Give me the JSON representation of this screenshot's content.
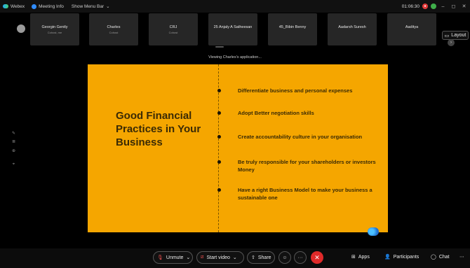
{
  "titlebar": {
    "app_name": "Webex",
    "meeting_info": "Meeting Info",
    "show_menu_bar": "Show Menu Bar",
    "time": "01:06:30"
  },
  "participants": [
    {
      "name": "Georgin Gently",
      "status": "Cohost, me"
    },
    {
      "name": "Charles",
      "status": "Cohost"
    },
    {
      "name": "CRJ",
      "status": "Cohost"
    },
    {
      "name": "25 Anjaly A Satheesan",
      "status": ""
    },
    {
      "name": "45_Bibin Benny",
      "status": ""
    },
    {
      "name": "Aadarsh Suresh",
      "status": ""
    },
    {
      "name": "Aaditya",
      "status": ""
    }
  ],
  "layout_label": "Layout",
  "viewing_text": "Viewing Charles's application...",
  "slide": {
    "title": "Good Financial Practices in Your Business",
    "bullets": [
      "Differentiate business and personal expenses",
      "Adopt Better negotiation skills",
      "Create accountability culture in your organisation",
      "Be truly responsible for your shareholders or investors Money",
      "Have a right Business Model to make your business a sustainable one"
    ],
    "colors": {
      "background": "#f5a600",
      "text": "#3a2a05"
    }
  },
  "controls": {
    "unmute": "Unmute",
    "start_video": "Start video",
    "share": "Share",
    "apps": "Apps",
    "participants": "Participants",
    "chat": "Chat"
  },
  "icons": [
    "webex-logo-icon",
    "meeting-info-icon",
    "chevron-down-icon",
    "recording-icon",
    "shield-icon",
    "minimize-icon",
    "maximize-icon",
    "close-icon",
    "layout-icon",
    "chevron-right-icon",
    "mic-muted-icon",
    "video-off-icon",
    "share-icon",
    "reactions-icon",
    "more-icon",
    "end-call-icon",
    "apps-icon",
    "participants-icon",
    "chat-icon"
  ]
}
